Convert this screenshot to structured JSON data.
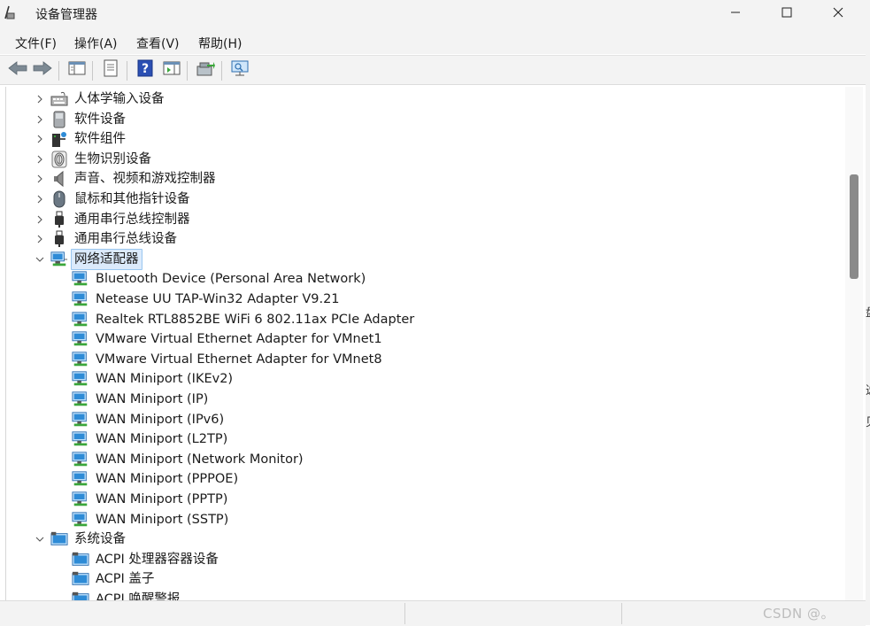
{
  "window": {
    "title": "设备管理器",
    "controls": {
      "minimize": "minimize-icon",
      "maximize": "maximize-icon",
      "close": "close-icon"
    }
  },
  "menu": [
    {
      "label": "文件(F)"
    },
    {
      "label": "操作(A)"
    },
    {
      "label": "查看(V)"
    },
    {
      "label": "帮助(H)"
    }
  ],
  "toolbar": [
    {
      "name": "back-button",
      "icon": "back-arrow-icon"
    },
    {
      "name": "forward-button",
      "icon": "forward-arrow-icon"
    },
    {
      "name": "show-hide-console-tree-button",
      "icon": "console-tree-icon"
    },
    {
      "name": "properties-button",
      "icon": "properties-icon"
    },
    {
      "name": "help-button",
      "icon": "help-icon"
    },
    {
      "name": "action-pane-button",
      "icon": "action-pane-icon"
    },
    {
      "name": "update-driver-button",
      "icon": "update-driver-icon"
    },
    {
      "name": "scan-hardware-button",
      "icon": "monitor-scan-icon"
    }
  ],
  "tree": {
    "categories_above": [
      {
        "label": "人体学输入设备",
        "icon": "hid-icon",
        "expanded": false
      },
      {
        "label": "软件设备",
        "icon": "software-device-icon",
        "expanded": false
      },
      {
        "label": "软件组件",
        "icon": "software-component-icon",
        "expanded": false
      },
      {
        "label": "生物识别设备",
        "icon": "biometric-icon",
        "expanded": false
      },
      {
        "label": "声音、视频和游戏控制器",
        "icon": "speaker-icon",
        "expanded": false
      },
      {
        "label": "鼠标和其他指针设备",
        "icon": "mouse-icon",
        "expanded": false
      },
      {
        "label": "通用串行总线控制器",
        "icon": "usb-icon",
        "expanded": false
      },
      {
        "label": "通用串行总线设备",
        "icon": "usb-icon",
        "expanded": false
      }
    ],
    "network_adapters": {
      "label": "网络适配器",
      "expanded": true,
      "selected": true,
      "children": [
        "Bluetooth Device (Personal Area Network)",
        "Netease UU TAP-Win32 Adapter V9.21",
        "Realtek RTL8852BE WiFi 6 802.11ax PCIe Adapter",
        "VMware Virtual Ethernet Adapter for VMnet1",
        "VMware Virtual Ethernet Adapter for VMnet8",
        "WAN Miniport (IKEv2)",
        "WAN Miniport (IP)",
        "WAN Miniport (IPv6)",
        "WAN Miniport (L2TP)",
        "WAN Miniport (Network Monitor)",
        "WAN Miniport (PPPOE)",
        "WAN Miniport (PPTP)",
        "WAN Miniport (SSTP)"
      ]
    },
    "system_devices": {
      "label": "系统设备",
      "expanded": true,
      "children": [
        "ACPI 处理器容器设备",
        "ACPI 盖子",
        "ACPI 唤醒警报"
      ]
    }
  },
  "watermark": "CSDN @。",
  "background_window_glyphs": [
    "盘",
    "选",
    "见"
  ],
  "colors": {
    "chrome": "#f3f3f3",
    "selection_bg": "#dbeafb",
    "selection_border": "#99c7f0",
    "network_icon": "#2e8bd6",
    "network_icon_green": "#3aa63a"
  }
}
